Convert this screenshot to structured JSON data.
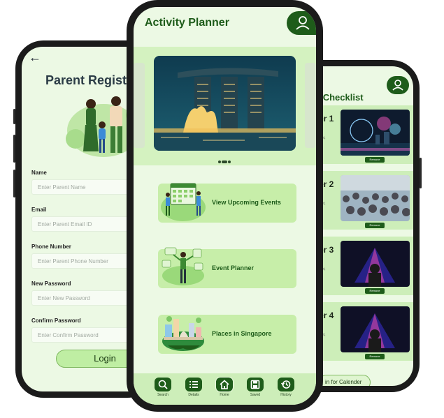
{
  "left_screen": {
    "title": "Parent Registr",
    "fields": [
      {
        "label": "Name",
        "placeholder": "Enter Parent Name"
      },
      {
        "label": "Email",
        "placeholder": "Enter Parent Email ID"
      },
      {
        "label": "Phone Number",
        "placeholder": "Enter Parent Phone Number"
      },
      {
        "label": "New Password",
        "placeholder": "Enter New Password"
      },
      {
        "label": "Confirm Password",
        "placeholder": "Enter Confirm Password"
      }
    ],
    "login_label": "Login",
    "icons": {
      "back": "back-arrow-icon"
    }
  },
  "center_screen": {
    "title": "Activity Planner",
    "menu": [
      {
        "label": "View Upcoming Events",
        "icon": "calendar-people-illustration"
      },
      {
        "label": "Event Planner",
        "icon": "planner-person-illustration"
      },
      {
        "label": "Places in Singapore",
        "icon": "singapore-landmarks-illustration"
      }
    ],
    "nav": [
      {
        "label": "Search",
        "icon": "search-icon"
      },
      {
        "label": "Details",
        "icon": "list-icon"
      },
      {
        "label": "Home",
        "icon": "home-icon"
      },
      {
        "label": "Saved",
        "icon": "save-icon"
      },
      {
        "label": "History",
        "icon": "history-icon"
      }
    ],
    "colors": {
      "primary": "#1e5c1a",
      "accent": "#c7eea9",
      "background": "#ecf9e4"
    }
  },
  "right_screen": {
    "title": "w Checklist",
    "items": [
      {
        "label": "er 1",
        "remove": "Remove"
      },
      {
        "label": "er 2",
        "remove": "Remove"
      },
      {
        "label": "er 3",
        "remove": "Remove"
      },
      {
        "label": "er 4",
        "remove": "Remove"
      }
    ],
    "bottom_button": "in for Calender"
  }
}
